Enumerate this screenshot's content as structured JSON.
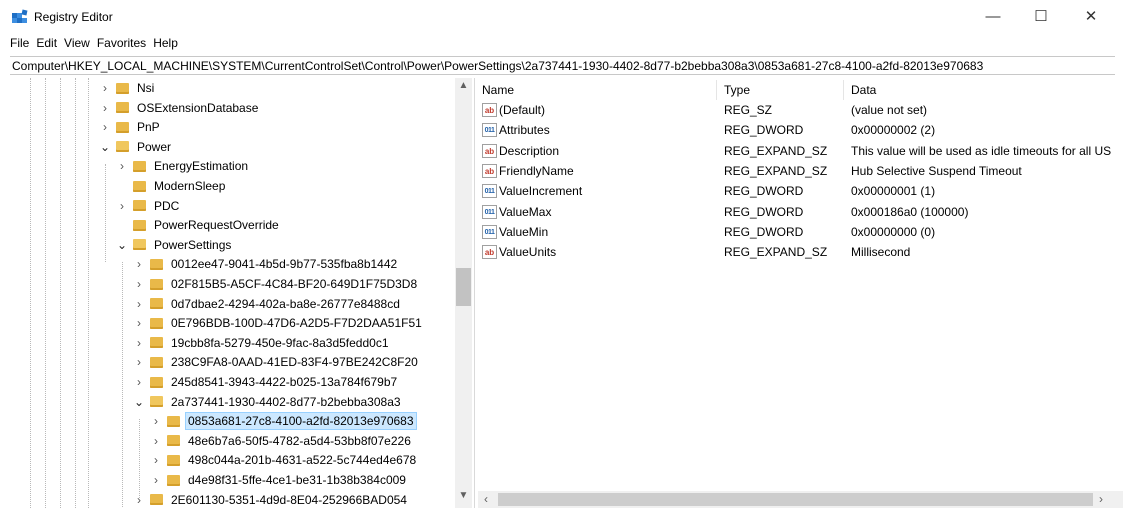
{
  "window": {
    "title": "Registry Editor",
    "controls": {
      "minimize": "—",
      "maximize": "☐",
      "close": "✕"
    }
  },
  "menu": [
    "File",
    "Edit",
    "View",
    "Favorites",
    "Help"
  ],
  "address": "Computer\\HKEY_LOCAL_MACHINE\\SYSTEM\\CurrentControlSet\\Control\\Power\\PowerSettings\\2a737441-1930-4402-8d77-b2bebba308a3\\0853a681-27c8-4100-a2fd-82013e970683",
  "tree": [
    {
      "label": "Nsi",
      "expander": "collapsed"
    },
    {
      "label": "OSExtensionDatabase",
      "expander": "collapsed"
    },
    {
      "label": "PnP",
      "expander": "collapsed"
    },
    {
      "label": "Power",
      "expander": "expanded"
    },
    {
      "label": "EnergyEstimation",
      "expander": "collapsed"
    },
    {
      "label": "ModernSleep",
      "expander": "none"
    },
    {
      "label": "PDC",
      "expander": "collapsed"
    },
    {
      "label": "PowerRequestOverride",
      "expander": "none"
    },
    {
      "label": "PowerSettings",
      "expander": "expanded"
    },
    {
      "label": "0012ee47-9041-4b5d-9b77-535fba8b1442",
      "expander": "collapsed"
    },
    {
      "label": "02F815B5-A5CF-4C84-BF20-649D1F75D3D8",
      "expander": "collapsed"
    },
    {
      "label": "0d7dbae2-4294-402a-ba8e-26777e8488cd",
      "expander": "collapsed"
    },
    {
      "label": "0E796BDB-100D-47D6-A2D5-F7D2DAA51F51",
      "expander": "collapsed"
    },
    {
      "label": "19cbb8fa-5279-450e-9fac-8a3d5fedd0c1",
      "expander": "collapsed"
    },
    {
      "label": "238C9FA8-0AAD-41ED-83F4-97BE242C8F20",
      "expander": "collapsed"
    },
    {
      "label": "245d8541-3943-4422-b025-13a784f679b7",
      "expander": "collapsed"
    },
    {
      "label": "2a737441-1930-4402-8d77-b2bebba308a3",
      "expander": "expanded"
    },
    {
      "label": "0853a681-27c8-4100-a2fd-82013e970683",
      "expander": "collapsed",
      "selected": true
    },
    {
      "label": "48e6b7a6-50f5-4782-a5d4-53bb8f07e226",
      "expander": "collapsed"
    },
    {
      "label": "498c044a-201b-4631-a522-5c744ed4e678",
      "expander": "collapsed"
    },
    {
      "label": "d4e98f31-5ffe-4ce1-be31-1b38b384c009",
      "expander": "collapsed"
    },
    {
      "label": "2E601130-5351-4d9d-8E04-252966BAD054",
      "expander": "collapsed"
    }
  ],
  "list": {
    "columns": [
      "Name",
      "Type",
      "Data"
    ],
    "rows": [
      {
        "icon": "string-value-icon",
        "name": "(Default)",
        "type": "REG_SZ",
        "data": "(value not set)"
      },
      {
        "icon": "dword-value-icon",
        "name": "Attributes",
        "type": "REG_DWORD",
        "data": "0x00000002 (2)"
      },
      {
        "icon": "string-value-icon",
        "name": "Description",
        "type": "REG_EXPAND_SZ",
        "data": "This value will be used as idle timeouts for all US"
      },
      {
        "icon": "string-value-icon",
        "name": "FriendlyName",
        "type": "REG_EXPAND_SZ",
        "data": "Hub Selective Suspend Timeout"
      },
      {
        "icon": "dword-value-icon",
        "name": "ValueIncrement",
        "type": "REG_DWORD",
        "data": "0x00000001 (1)"
      },
      {
        "icon": "dword-value-icon",
        "name": "ValueMax",
        "type": "REG_DWORD",
        "data": "0x000186a0 (100000)"
      },
      {
        "icon": "dword-value-icon",
        "name": "ValueMin",
        "type": "REG_DWORD",
        "data": "0x00000000 (0)"
      },
      {
        "icon": "string-value-icon",
        "name": "ValueUnits",
        "type": "REG_EXPAND_SZ",
        "data": "Millisecond"
      }
    ]
  },
  "colors": {
    "selection": "#cce8ff",
    "folder": "#e9b949",
    "scrollbar_track": "#f0f0f0"
  },
  "icon_glyphs": {
    "string": "ab",
    "dword": "011"
  }
}
